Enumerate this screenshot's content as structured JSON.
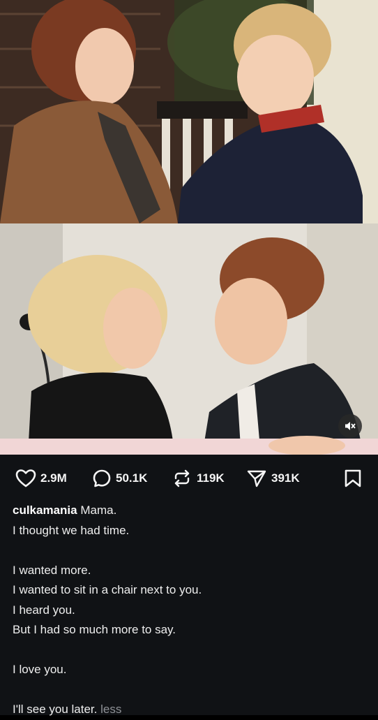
{
  "post": {
    "username": "culkamania",
    "caption_lines": [
      "Mama.",
      "I thought we had time.",
      "",
      "I wanted more.",
      "I wanted to sit in a chair next to you.",
      "I heard you.",
      "But I had so much more to say.",
      "",
      "I love you.",
      "",
      "I'll see you later."
    ],
    "less_label": "less"
  },
  "actions": {
    "likes": "2.9M",
    "comments": "50.1K",
    "reposts": "119K",
    "shares": "391K"
  },
  "colors": {
    "background": "#101215",
    "text": "#eeeeee",
    "muted": "#8e9196"
  }
}
